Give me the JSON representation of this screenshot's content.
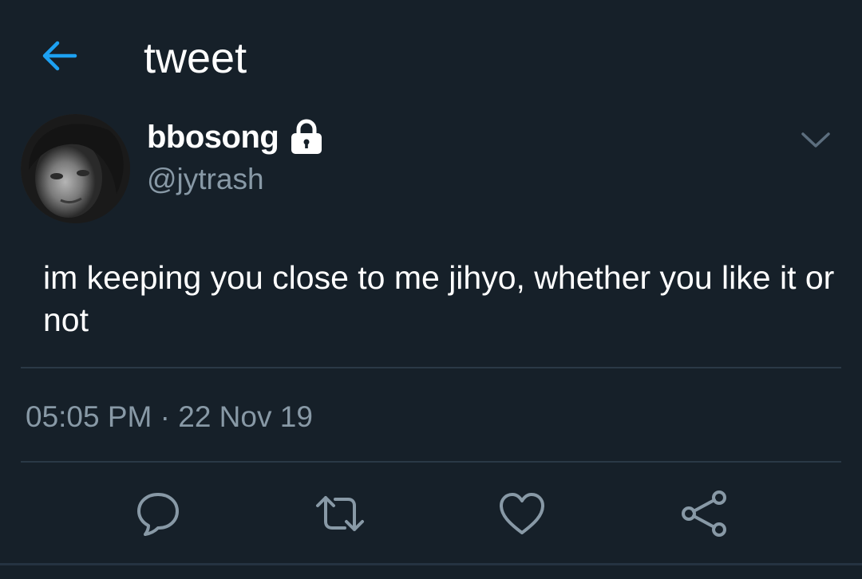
{
  "header": {
    "title": "tweet",
    "back_icon": "arrow-left-icon"
  },
  "author": {
    "display_name": "bbosong",
    "handle": "@jytrash",
    "protected_icon": "lock-icon",
    "menu_icon": "chevron-down-icon"
  },
  "tweet": {
    "text": "im keeping you close to me jihyo, whether you like it or not",
    "timestamp": "05:05 PM · 22 Nov 19"
  },
  "actions": [
    {
      "name": "reply",
      "icon": "speech-bubble-icon"
    },
    {
      "name": "retweet",
      "icon": "retweet-icon"
    },
    {
      "name": "like",
      "icon": "heart-icon"
    },
    {
      "name": "share",
      "icon": "share-icon"
    }
  ],
  "colors": {
    "background": "#162029",
    "accent": "#1da1f2",
    "secondary_text": "#8899a6",
    "divider": "#2a3946"
  }
}
